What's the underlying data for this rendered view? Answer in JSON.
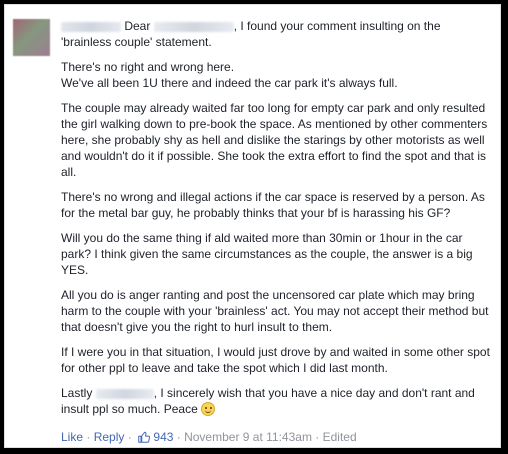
{
  "comment": {
    "intro_prefix": "Dear",
    "intro_text": ", I found your comment insulting on the 'brainless couple' statement.",
    "paragraphs": [
      [
        "There's no right and wrong here.",
        "We've all been 1U there and indeed the car park it's always full."
      ],
      [
        "The couple may already waited far too long for empty car park and only resulted the girl walking down to pre-book the space. As mentioned by other commenters here, she probably shy as hell and dislike the starings by other motorists as well and wouldn't do it if possible. She took the extra effort to find the spot and that is all."
      ],
      [
        "There's no wrong and illegal actions if the car space is reserved by a person. As for the metal bar guy, he probably thinks that your bf is harassing his GF?"
      ],
      [
        "Will you do the same thing if ald waited more than 30min or 1hour in the car park? I think given the same circumstances as the couple, the answer is a big YES."
      ],
      [
        "All you do is anger ranting and post the uncensored car plate which may bring harm to the couple with your 'brainless' act. You may not accept their method but that doesn't give you the right to hurl insult to them."
      ],
      [
        "If I were you in that situation, I would just drove by and waited in some other spot for other ppl to leave and take the spot which I did last month."
      ]
    ],
    "closing_prefix": "Lastly",
    "closing_text": ", I sincerely wish that you have a nice day and don't rant and insult ppl so much. Peace"
  },
  "actions": {
    "like": "Like",
    "sep1": " · ",
    "reply": "Reply",
    "sep2": " · ",
    "like_count": "943",
    "sep3": " · ",
    "timestamp": "November 9 at 11:43am",
    "sep4": " · ",
    "edited": "Edited"
  },
  "colors": {
    "text": "#1d2129",
    "link": "#4267b2",
    "meta": "#90949c",
    "frame": "#000000"
  },
  "icons": [
    "avatar",
    "smile-emoji-icon",
    "thumbs-up-icon"
  ]
}
